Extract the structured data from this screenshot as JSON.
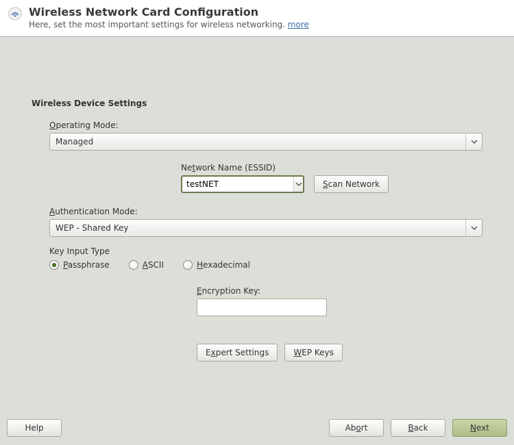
{
  "header": {
    "title": "Wireless Network Card Configuration",
    "subtitle_text": "Here, set the most important settings for wireless networking. ",
    "more_link": "more"
  },
  "section_title": "Wireless Device Settings",
  "operating_mode": {
    "label_pre": "O",
    "label_rest": "perating Mode:",
    "value": "Managed"
  },
  "essid": {
    "label_pre": "Ne",
    "label_u": "t",
    "label_rest": "work Name (ESSID)",
    "value": "testNET"
  },
  "scan_button": {
    "pre": "S",
    "rest": "can Network"
  },
  "auth_mode": {
    "label_pre": "A",
    "label_rest": "uthentication Mode:",
    "value": "WEP - Shared Key"
  },
  "key_input_type": {
    "label": "Key Input Type",
    "options": {
      "passphrase": {
        "u": "P",
        "rest": "assphrase"
      },
      "ascii": {
        "u": "A",
        "rest": "SCII"
      },
      "hex": {
        "u": "H",
        "rest": "exadecimal"
      }
    },
    "selected": "passphrase"
  },
  "encryption_key": {
    "label_u": "E",
    "label_rest": "ncryption Key:",
    "value": ""
  },
  "expert_button": {
    "pre": "E",
    "u": "x",
    "rest": "pert Settings"
  },
  "wep_button": {
    "u": "W",
    "rest": "EP Keys"
  },
  "footer": {
    "help": "Help",
    "abort": {
      "pre": "Ab",
      "u": "o",
      "rest": "rt"
    },
    "back": {
      "u": "B",
      "rest": "ack"
    },
    "next": {
      "u": "N",
      "rest": "ext"
    }
  }
}
